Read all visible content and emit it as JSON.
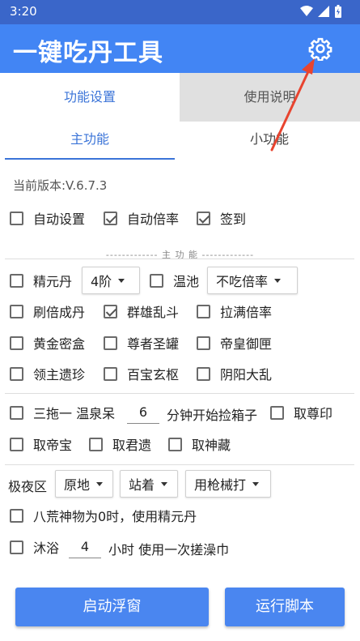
{
  "status_bar": {
    "time": "3:20"
  },
  "app": {
    "title": "一键吃丹工具"
  },
  "tabs": {
    "function_settings": "功能设置",
    "usage_instructions": "使用说明"
  },
  "sub_tabs": {
    "main_function": "主功能",
    "small_function": "小功能"
  },
  "version": "当前版本:V.6.7.3",
  "row1": {
    "auto_settings": {
      "label": "自动设置",
      "checked": false
    },
    "auto_multiplier": {
      "label": "自动倍率",
      "checked": true
    },
    "sign_in": {
      "label": "签到",
      "checked": true
    }
  },
  "section_label": "------------- 主 功 能 -------------",
  "row2": {
    "jingyuandan": {
      "label": "精元丹",
      "checked": false
    },
    "level_dropdown": "4阶",
    "hot_spring": {
      "label": "温池",
      "checked": false
    },
    "multiplier_dropdown": "不吃倍率"
  },
  "row3": {
    "brush_multiplier": {
      "label": "刷倍成丹",
      "checked": false
    },
    "heroes_melee": {
      "label": "群雄乱斗",
      "checked": true
    },
    "pull_full_multiplier": {
      "label": "拉满倍率",
      "checked": false
    }
  },
  "row4": {
    "gold_box": {
      "label": "黄金密盒",
      "checked": false
    },
    "venerable_jar": {
      "label": "尊者圣罐",
      "checked": false
    },
    "emperor_box": {
      "label": "帝皇御匣",
      "checked": false
    }
  },
  "row5": {
    "lord_relics": {
      "label": "领主遗珍",
      "checked": false
    },
    "treasure_hub": {
      "label": "百宝玄枢",
      "checked": false
    },
    "yin_yang_chaos": {
      "label": "阴阳大乱",
      "checked": false
    }
  },
  "row6": {
    "three_drag": {
      "label": "三拖一 温泉呆",
      "checked": false
    },
    "minutes_value": "6",
    "minutes_suffix": "分钟开始捡箱子",
    "take_venerable_seal": {
      "label": "取尊印",
      "checked": false
    }
  },
  "row7": {
    "take_emperor_treasure": {
      "label": "取帝宝",
      "checked": false
    },
    "take_lord_relic": {
      "label": "取君遗",
      "checked": false
    },
    "take_divine_collection": {
      "label": "取神藏",
      "checked": false
    }
  },
  "row8": {
    "label": "极夜区",
    "position_dropdown": "原地",
    "stance_dropdown": "站着",
    "weapon_dropdown": "用枪械打"
  },
  "row9": {
    "label": "八荒神物为0时，使用精元丹",
    "checked": false
  },
  "row10": {
    "label": "沐浴",
    "checked": false,
    "hours_value": "4",
    "suffix": "小时 使用一次搓澡巾"
  },
  "buttons": {
    "start_floating_window": "启动浮窗",
    "run_script": "运行脚本"
  },
  "colors": {
    "app_bar": "#4285f4",
    "status_bar": "#3a66c9",
    "accent": "#3b74d8",
    "button": "#4a86f0",
    "arrow": "#e8442f"
  }
}
